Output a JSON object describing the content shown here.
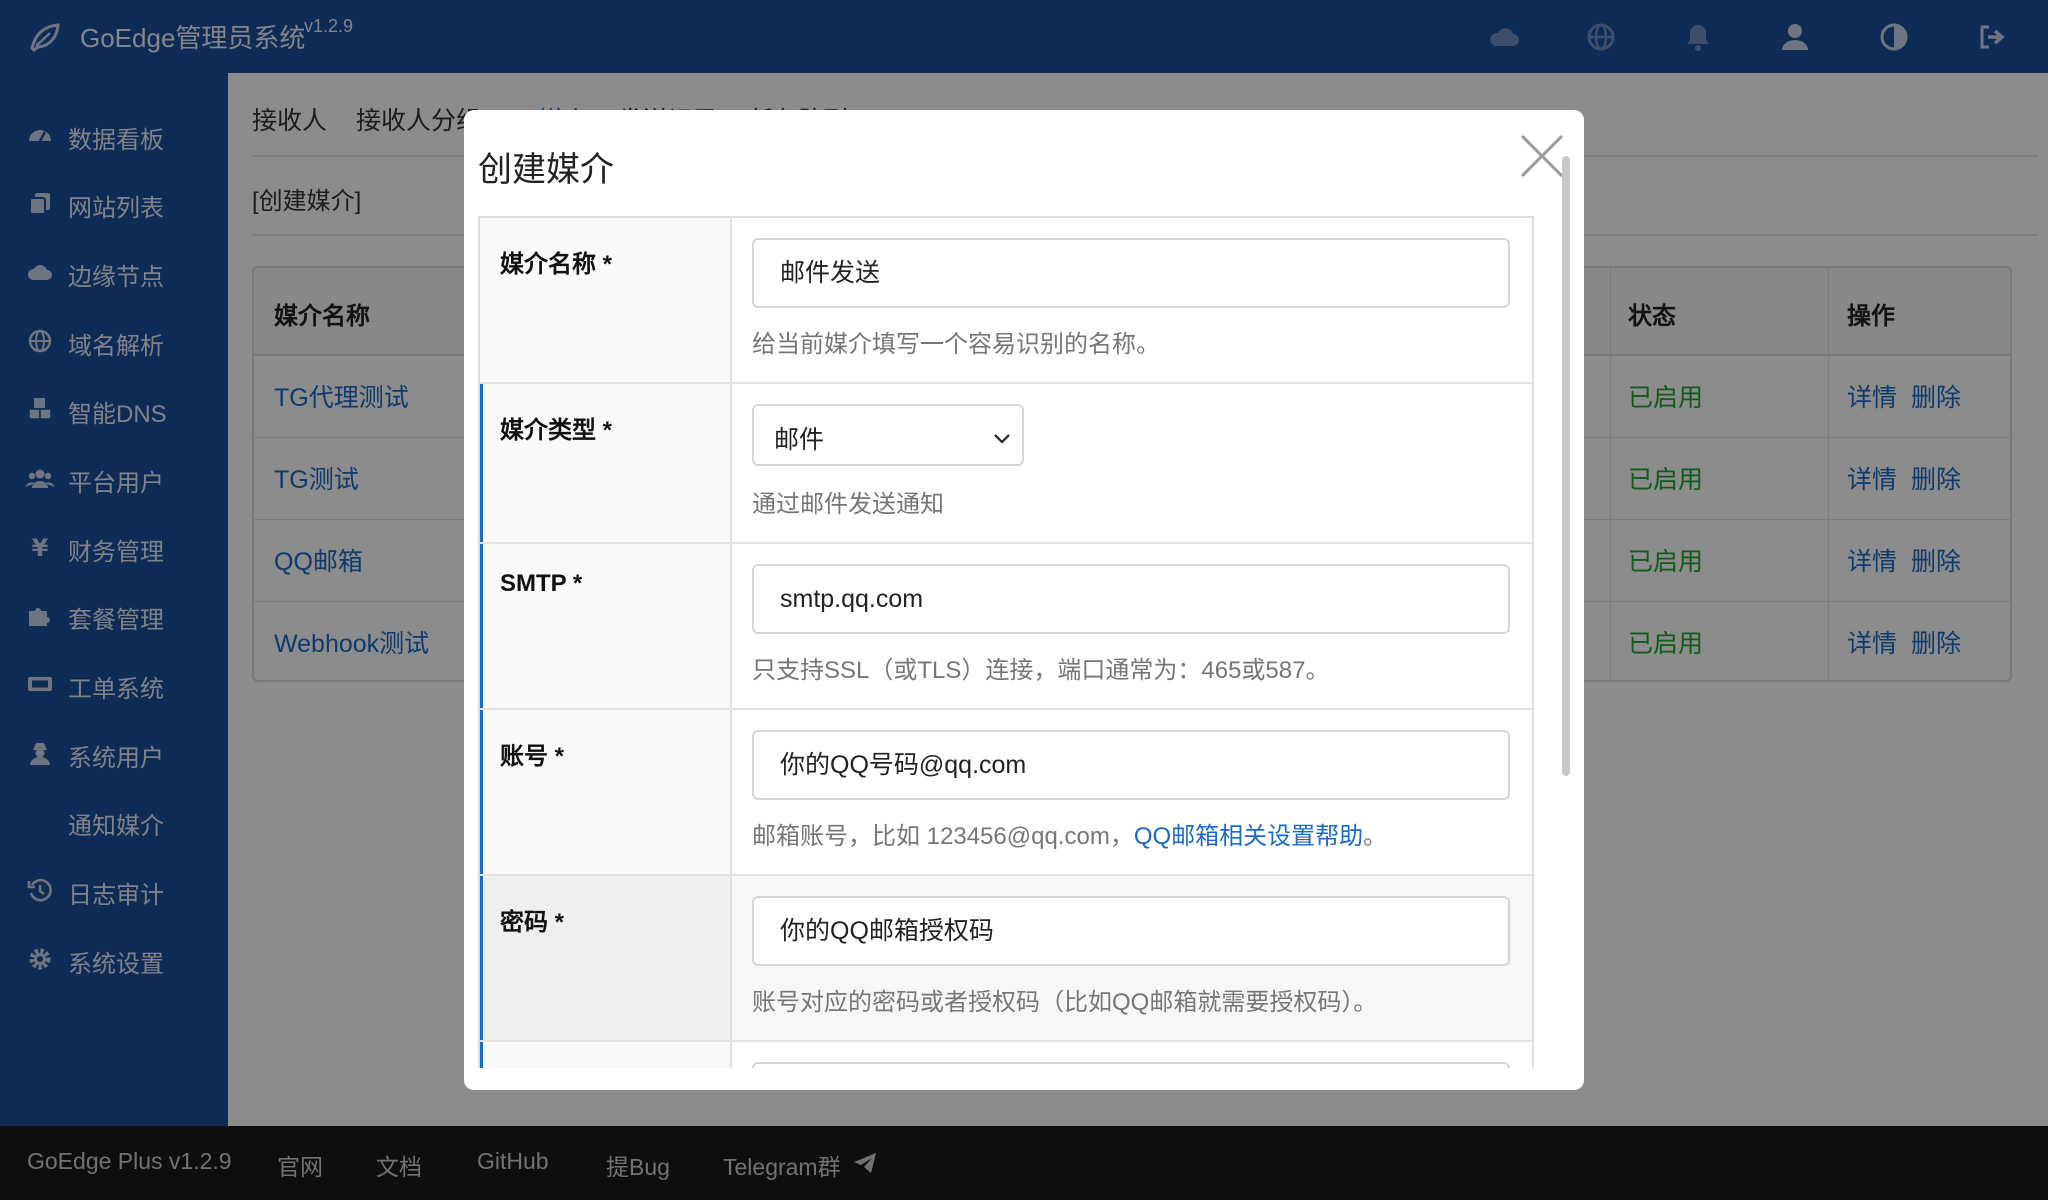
{
  "app": {
    "title": "GoEdge管理员系统",
    "version": "v1.2.9"
  },
  "topbar_icons": [
    "cloud-icon",
    "globe-icon",
    "bell-icon",
    "user-icon",
    "contrast-icon",
    "logout-icon"
  ],
  "sidebar": {
    "items": [
      {
        "label": "数据看板",
        "icon": "dashboard-icon"
      },
      {
        "label": "网站列表",
        "icon": "copy-icon"
      },
      {
        "label": "边缘节点",
        "icon": "cloud-icon"
      },
      {
        "label": "域名解析",
        "icon": "globe-icon"
      },
      {
        "label": "智能DNS",
        "icon": "cubes-icon"
      },
      {
        "label": "平台用户",
        "icon": "users-icon"
      },
      {
        "label": "财务管理",
        "icon": "yen-icon"
      },
      {
        "label": "套餐管理",
        "icon": "puzzle-icon"
      },
      {
        "label": "工单系统",
        "icon": "ticket-icon"
      },
      {
        "label": "系统用户",
        "icon": "user-secret-icon"
      },
      {
        "label": "通知媒介",
        "icon": ""
      },
      {
        "label": "日志审计",
        "icon": "history-icon"
      },
      {
        "label": "系统设置",
        "icon": "gear-icon"
      }
    ]
  },
  "main": {
    "tabs": [
      {
        "label": "接收人"
      },
      {
        "label": "接收人分组"
      },
      {
        "label": "媒介"
      },
      {
        "label": "发送记录"
      },
      {
        "label": "任务队列"
      }
    ],
    "create_link": "[创建媒介]",
    "table": {
      "headers": {
        "name": "媒介名称",
        "status": "状态",
        "ops": "操作"
      },
      "rows": [
        {
          "name": "TG代理测试",
          "status": "已启用",
          "detail": "详情",
          "delete": "删除"
        },
        {
          "name": "TG测试",
          "status": "已启用",
          "detail": "详情",
          "delete": "删除"
        },
        {
          "name": "QQ邮箱",
          "status": "已启用",
          "detail": "详情",
          "delete": "删除"
        },
        {
          "name": "Webhook测试",
          "status": "已启用",
          "detail": "详情",
          "delete": "删除"
        }
      ]
    }
  },
  "modal": {
    "title": "创建媒介",
    "fields": [
      {
        "label": "媒介名称 *",
        "value": "邮件发送",
        "help": "给当前媒介填写一个容易识别的名称。"
      },
      {
        "label": "媒介类型 *",
        "value": "邮件",
        "help": "通过邮件发送通知"
      },
      {
        "label": "SMTP *",
        "value": "smtp.qq.com",
        "help": "只支持SSL（或TLS）连接，端口通常为：465或587。"
      },
      {
        "label": "账号 *",
        "value": "你的QQ号码@qq.com",
        "help": "邮箱账号，比如 123456@qq.com，",
        "help_link": "QQ邮箱相关设置帮助",
        "help_tail": "。"
      },
      {
        "label": "密码 *",
        "value": "你的QQ邮箱授权码",
        "help": "账号对应的密码或者授权码（比如QQ邮箱就需要授权码）。"
      }
    ]
  },
  "footer": {
    "items": [
      "GoEdge Plus v1.2.9",
      "官网",
      "文档",
      "GitHub",
      "提Bug",
      "Telegram群"
    ]
  },
  "colors": {
    "brand": "#1b4f9c",
    "link": "#1b6ac9",
    "enabled": "#21a532",
    "footer_bg": "#1b1b1b"
  }
}
